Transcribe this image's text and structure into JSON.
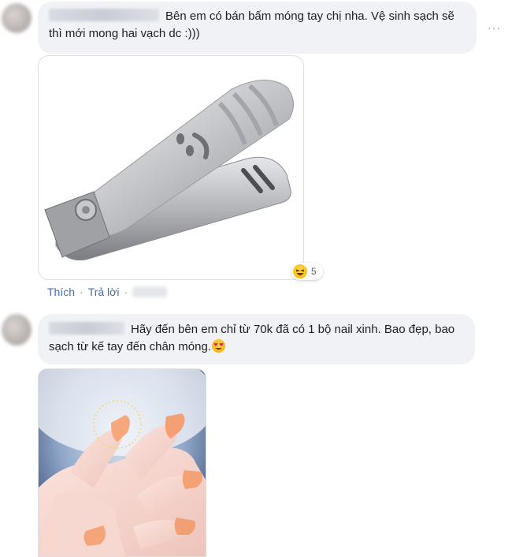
{
  "comment1": {
    "text": "Bên em có bán bấm móng tay chị nha. Vệ sinh sạch sẽ thì mới mong hai vạch dc :)))",
    "reaction_count": "5",
    "actions": {
      "like": "Thích",
      "reply": "Trả lời",
      "separator": "·"
    }
  },
  "comment2": {
    "text": "Hãy đến bên em chỉ từ 70k đã có 1 bộ nail xinh. Bao đẹp, bao sạch từ kế tay đến chân móng."
  },
  "more_options": "···",
  "colors": {
    "bubble": "#f0f2f5",
    "link": "#4b6da8",
    "reaction_yellow": "#ffd84d"
  }
}
